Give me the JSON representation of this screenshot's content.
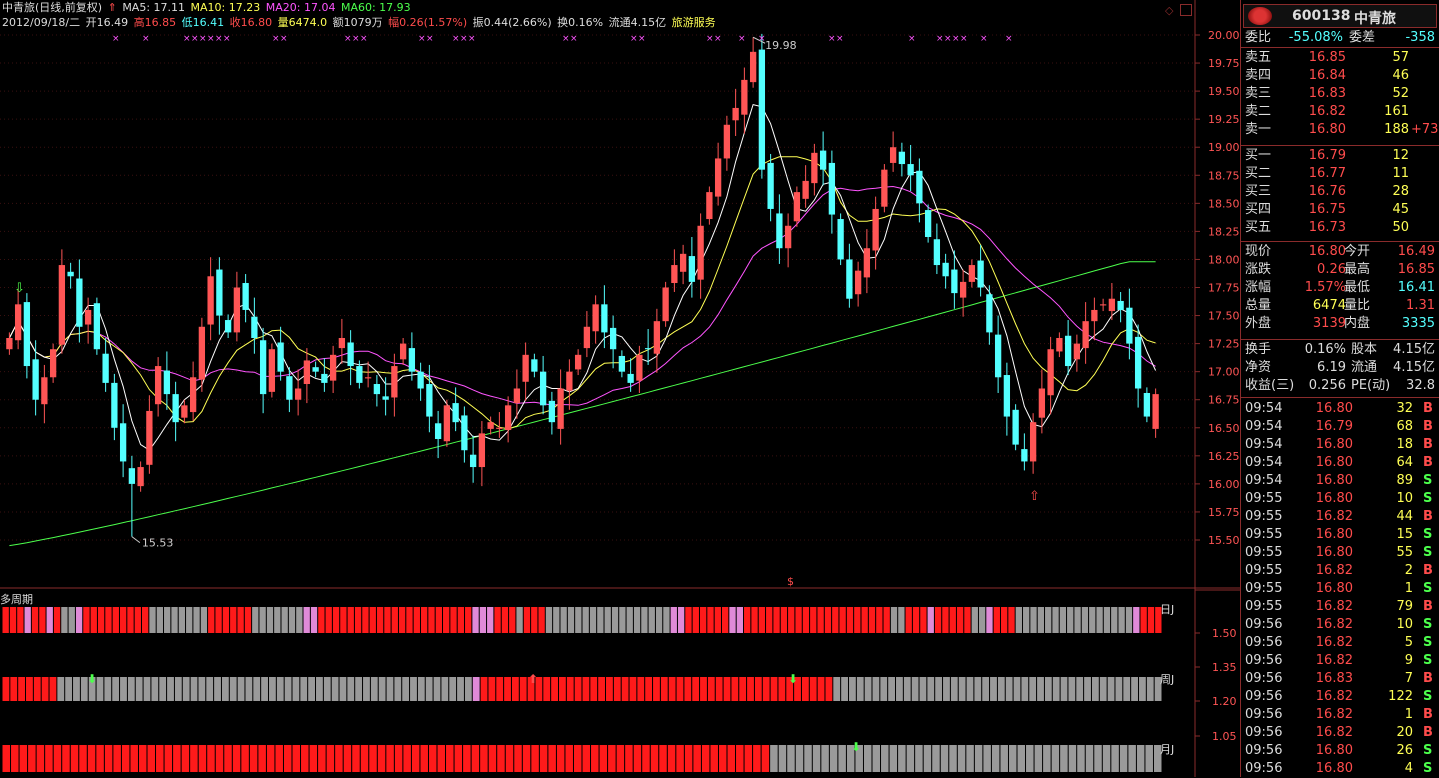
{
  "header": {
    "title": "中青旅(日线,前复权)",
    "ma5": "MA5: 17.11",
    "ma10": "MA10: 17.23",
    "ma20": "MA20: 17.04",
    "ma60": "MA60: 17.93",
    "date": "2012/09/18/二",
    "open": "开16.49",
    "high": "高16.85",
    "low": "低16.41",
    "close": "收16.80",
    "volume": "量6474.0",
    "amount": "额1079万",
    "change": "幅0.26(1.57%)",
    "amplitude": "振0.44(2.66%)",
    "turnover": "换0.16%",
    "float": "流通4.15亿",
    "industry": "旅游服务"
  },
  "price_axis": {
    "ticks": [
      "20.00",
      "19.75",
      "19.50",
      "19.25",
      "19.00",
      "18.75",
      "18.50",
      "18.25",
      "18.00",
      "17.75",
      "17.50",
      "17.25",
      "17.00",
      "16.75",
      "16.50",
      "16.25",
      "16.00",
      "15.75",
      "15.50"
    ]
  },
  "annotations": {
    "max_label": "19.98",
    "min_label": "15.53",
    "dollar_mark": "$"
  },
  "indicator": {
    "title": "多周期",
    "axis_ticks": [
      "1.50",
      "1.35",
      "1.20",
      "1.05"
    ],
    "row_labels": [
      "日J",
      "周J",
      "月J"
    ]
  },
  "chart_data": {
    "type": "candlestick",
    "title": "中青旅(日线,前复权)",
    "ylim": [
      15.4,
      20.08
    ],
    "y_ticks": [
      20.0,
      19.75,
      19.5,
      19.25,
      19.0,
      18.75,
      18.5,
      18.25,
      18.0,
      17.75,
      17.5,
      17.25,
      17.0,
      16.75,
      16.5,
      16.25,
      16.0,
      15.75,
      15.5
    ],
    "highest": 19.98,
    "lowest": 15.53,
    "last_bar": {
      "open": 16.49,
      "high": 16.85,
      "low": 16.41,
      "close": 16.8
    },
    "ma_values": {
      "MA5": 17.11,
      "MA10": 17.23,
      "MA20": 17.04,
      "MA60": 17.93
    },
    "closes": [
      17.3,
      17.6,
      17.05,
      16.75,
      16.95,
      17.2,
      17.95,
      17.85,
      17.4,
      17.55,
      17.2,
      16.9,
      16.5,
      16.2,
      16.0,
      16.15,
      16.65,
      17.05,
      16.8,
      16.55,
      16.7,
      16.95,
      17.4,
      17.85,
      17.5,
      17.35,
      17.75,
      17.55,
      17.3,
      16.8,
      17.2,
      17.0,
      16.75,
      16.85,
      17.1,
      17.0,
      16.9,
      17.15,
      17.3,
      17.05,
      16.9,
      16.95,
      16.8,
      16.75,
      17.05,
      17.25,
      17.0,
      16.85,
      16.6,
      16.4,
      16.7,
      16.55,
      16.3,
      16.15,
      16.45,
      16.55,
      16.5,
      16.7,
      16.85,
      17.15,
      17.0,
      16.7,
      16.55,
      16.85,
      17.0,
      17.15,
      17.4,
      17.6,
      17.35,
      17.2,
      17.0,
      16.9,
      17.15,
      17.2,
      17.45,
      17.75,
      17.95,
      18.05,
      17.8,
      18.3,
      18.6,
      18.9,
      19.2,
      19.35,
      19.6,
      19.85,
      18.8,
      18.45,
      18.1,
      18.3,
      18.6,
      18.7,
      18.95,
      18.8,
      18.4,
      18.0,
      17.65,
      17.9,
      18.1,
      18.45,
      18.8,
      19.0,
      18.85,
      18.75,
      18.5,
      18.2,
      17.95,
      17.85,
      17.7,
      17.8,
      17.95,
      17.75,
      17.35,
      16.95,
      16.6,
      16.35,
      16.2,
      16.55,
      16.85,
      17.2,
      17.3,
      17.05,
      17.25,
      17.45,
      17.55,
      17.6,
      17.65,
      17.55,
      17.25,
      16.85,
      16.6,
      16.8
    ],
    "ma_colors": {
      "MA5": "#ffffff",
      "MA10": "#ffff55",
      "MA20": "#ff55ff",
      "MA60": "#4cff4c"
    },
    "up_color": "#ff5555",
    "down_color": "#54ffff"
  },
  "multi_period": {
    "day": "RRRPRRPRGGPRRRRRRRRRGGGGGGGGRRRRRRGGGGGGGPPRRRRRRRRRRRRRRRRRRRRRPPPRRRGRRRGGGGGGGGGGGGGGGGGPPRRRRRRPPRRRRRRRRRRRRRRRRRRRRGGRRRPRRRRRGGPRRRGGGGGGGGGGGGGGGGPRRR",
    "week": "RRRRRRRGGGGGGGGGGGGGGGGGGGGGGGGGGGGGGGGGGGGGGGGGGGGGGGGGGGGGPRRRRRRRRRRRRRRRRRRRRRRRRRRRRRRRRRRRRRRRRRRRRRGGGGGGGGGGGGGGGGGGGGGGGGGGGGGGGGGGGGGGGGGG",
    "month": "RRRRRRRRRRRRRRRRRRRRRRRRRRRRRRRRRRRRRRRRRRRRRRRRRRRRRRRRRRRRRRRRRRRRRRRRRRRRRRRRRRRRRRRRRRGGGGGGGGGGGGGGGGGGGGGGGGGGGGGGGGGGGGGGGGGGGGGG"
  },
  "quote": {
    "code": "600138",
    "name": "中青旅",
    "weibi_label": "委比",
    "weibi": "-55.08%",
    "weicha_label": "委差",
    "weicha": "-358",
    "asks": [
      {
        "label": "卖五",
        "price": "16.85",
        "vol": "57",
        "extra": ""
      },
      {
        "label": "卖四",
        "price": "16.84",
        "vol": "46",
        "extra": ""
      },
      {
        "label": "卖三",
        "price": "16.83",
        "vol": "52",
        "extra": ""
      },
      {
        "label": "卖二",
        "price": "16.82",
        "vol": "161",
        "extra": ""
      },
      {
        "label": "卖一",
        "price": "16.80",
        "vol": "188",
        "extra": "+73"
      }
    ],
    "bids": [
      {
        "label": "买一",
        "price": "16.79",
        "vol": "12"
      },
      {
        "label": "买二",
        "price": "16.77",
        "vol": "11"
      },
      {
        "label": "买三",
        "price": "16.76",
        "vol": "28"
      },
      {
        "label": "买四",
        "price": "16.75",
        "vol": "45"
      },
      {
        "label": "买五",
        "price": "16.73",
        "vol": "50"
      }
    ],
    "stats": [
      {
        "l1": "现价",
        "v1": "16.80",
        "l2": "今开",
        "v2": "16.49"
      },
      {
        "l1": "涨跌",
        "v1": "0.26",
        "l2": "最高",
        "v2": "16.85"
      },
      {
        "l1": "涨幅",
        "v1": "1.57%",
        "l2": "最低",
        "v2": "16.41"
      },
      {
        "l1": "总量",
        "v1": "6474",
        "l2": "量比",
        "v2": "1.31"
      },
      {
        "l1": "外盘",
        "v1": "3139",
        "l2": "内盘",
        "v2": "3335"
      }
    ],
    "fund": [
      {
        "l1": "换手",
        "v1": "0.16%",
        "l2": "股本",
        "v2": "4.15亿"
      },
      {
        "l1": "净资",
        "v1": "6.19",
        "l2": "流通",
        "v2": "4.15亿"
      },
      {
        "l1": "收益(三)",
        "v1": "0.256",
        "l2": "PE(动)",
        "v2": "32.8"
      }
    ],
    "ticks": [
      {
        "t": "09:54",
        "p": "16.80",
        "q": "32",
        "d": "B"
      },
      {
        "t": "09:54",
        "p": "16.79",
        "q": "68",
        "d": "B"
      },
      {
        "t": "09:54",
        "p": "16.80",
        "q": "18",
        "d": "B"
      },
      {
        "t": "09:54",
        "p": "16.80",
        "q": "64",
        "d": "B"
      },
      {
        "t": "09:54",
        "p": "16.80",
        "q": "89",
        "d": "S"
      },
      {
        "t": "09:55",
        "p": "16.80",
        "q": "10",
        "d": "S"
      },
      {
        "t": "09:55",
        "p": "16.82",
        "q": "44",
        "d": "B"
      },
      {
        "t": "09:55",
        "p": "16.80",
        "q": "15",
        "d": "S"
      },
      {
        "t": "09:55",
        "p": "16.80",
        "q": "55",
        "d": "S"
      },
      {
        "t": "09:55",
        "p": "16.82",
        "q": "2",
        "d": "B"
      },
      {
        "t": "09:55",
        "p": "16.80",
        "q": "1",
        "d": "S"
      },
      {
        "t": "09:55",
        "p": "16.82",
        "q": "79",
        "d": "B"
      },
      {
        "t": "09:56",
        "p": "16.82",
        "q": "10",
        "d": "S"
      },
      {
        "t": "09:56",
        "p": "16.82",
        "q": "5",
        "d": "S"
      },
      {
        "t": "09:56",
        "p": "16.82",
        "q": "9",
        "d": "S"
      },
      {
        "t": "09:56",
        "p": "16.83",
        "q": "7",
        "d": "B"
      },
      {
        "t": "09:56",
        "p": "16.82",
        "q": "122",
        "d": "S"
      },
      {
        "t": "09:56",
        "p": "16.82",
        "q": "1",
        "d": "B"
      },
      {
        "t": "09:56",
        "p": "16.82",
        "q": "20",
        "d": "B"
      },
      {
        "t": "09:56",
        "p": "16.80",
        "q": "26",
        "d": "S"
      },
      {
        "t": "09:56",
        "p": "16.80",
        "q": "4",
        "d": "S"
      }
    ]
  }
}
